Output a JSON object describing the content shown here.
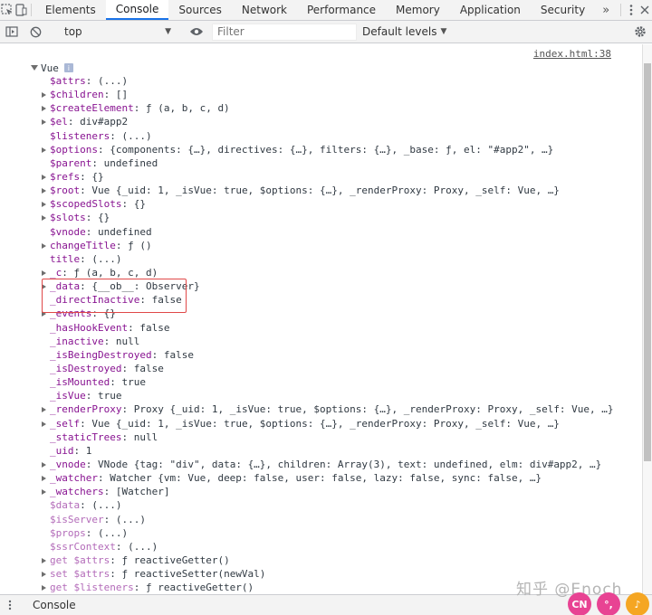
{
  "tabs": {
    "items": [
      "Elements",
      "Console",
      "Sources",
      "Network",
      "Performance",
      "Memory",
      "Application",
      "Security"
    ],
    "active": "Console",
    "more": "»"
  },
  "toolbar": {
    "context": "top",
    "filter_placeholder": "Filter",
    "levels": "Default levels"
  },
  "console": {
    "source_link": "index.html:38",
    "root_label": "Vue",
    "rows": [
      {
        "key": "$attrs",
        "val": "(...)",
        "expandable": false,
        "dim": false
      },
      {
        "key": "$children",
        "val": "[]",
        "expandable": true,
        "dim": false
      },
      {
        "key": "$createElement",
        "val": "ƒ (a, b, c, d)",
        "expandable": true,
        "dim": false
      },
      {
        "key": "$el",
        "val": "div#app2",
        "expandable": true,
        "dim": false
      },
      {
        "key": "$listeners",
        "val": "(...)",
        "expandable": false,
        "dim": false
      },
      {
        "key": "$options",
        "val": "{components: {…}, directives: {…}, filters: {…}, _base: ƒ, el: \"#app2\", …}",
        "expandable": true,
        "dim": false
      },
      {
        "key": "$parent",
        "val": "undefined",
        "expandable": false,
        "dim": false
      },
      {
        "key": "$refs",
        "val": "{}",
        "expandable": true,
        "dim": false
      },
      {
        "key": "$root",
        "val": "Vue {_uid: 1, _isVue: true, $options: {…}, _renderProxy: Proxy, _self: Vue, …}",
        "expandable": true,
        "dim": false
      },
      {
        "key": "$scopedSlots",
        "val": "{}",
        "expandable": true,
        "dim": false
      },
      {
        "key": "$slots",
        "val": "{}",
        "expandable": true,
        "dim": false
      },
      {
        "key": "$vnode",
        "val": "undefined",
        "expandable": false,
        "dim": false
      },
      {
        "key": "changeTitle",
        "val": "ƒ ()",
        "expandable": true,
        "dim": false
      },
      {
        "key": "title",
        "val": "(...)",
        "expandable": false,
        "dim": false
      },
      {
        "key": "_c",
        "val": "ƒ (a, b, c, d)",
        "expandable": true,
        "dim": false
      },
      {
        "key": "_data",
        "val": "{__ob__: Observer}",
        "expandable": true,
        "dim": false
      },
      {
        "key": "_directInactive",
        "val": "false",
        "expandable": false,
        "dim": false
      },
      {
        "key": "_events",
        "val": "{}",
        "expandable": true,
        "dim": false
      },
      {
        "key": "_hasHookEvent",
        "val": "false",
        "expandable": false,
        "dim": false
      },
      {
        "key": "_inactive",
        "val": "null",
        "expandable": false,
        "dim": false
      },
      {
        "key": "_isBeingDestroyed",
        "val": "false",
        "expandable": false,
        "dim": false
      },
      {
        "key": "_isDestroyed",
        "val": "false",
        "expandable": false,
        "dim": false
      },
      {
        "key": "_isMounted",
        "val": "true",
        "expandable": false,
        "dim": false
      },
      {
        "key": "_isVue",
        "val": "true",
        "expandable": false,
        "dim": false
      },
      {
        "key": "_renderProxy",
        "val": "Proxy {_uid: 1, _isVue: true, $options: {…}, _renderProxy: Proxy, _self: Vue, …}",
        "expandable": true,
        "dim": false
      },
      {
        "key": "_self",
        "val": "Vue {_uid: 1, _isVue: true, $options: {…}, _renderProxy: Proxy, _self: Vue, …}",
        "expandable": true,
        "dim": false
      },
      {
        "key": "_staticTrees",
        "val": "null",
        "expandable": false,
        "dim": false
      },
      {
        "key": "_uid",
        "val": "1",
        "expandable": false,
        "dim": false
      },
      {
        "key": "_vnode",
        "val": "VNode {tag: \"div\", data: {…}, children: Array(3), text: undefined, elm: div#app2, …}",
        "expandable": true,
        "dim": false
      },
      {
        "key": "_watcher",
        "val": "Watcher {vm: Vue, deep: false, user: false, lazy: false, sync: false, …}",
        "expandable": true,
        "dim": false
      },
      {
        "key": "_watchers",
        "val": "[Watcher]",
        "expandable": true,
        "dim": false
      },
      {
        "key": "$data",
        "val": "(...)",
        "expandable": false,
        "dim": true
      },
      {
        "key": "$isServer",
        "val": "(...)",
        "expandable": false,
        "dim": true
      },
      {
        "key": "$props",
        "val": "(...)",
        "expandable": false,
        "dim": true
      },
      {
        "key": "$ssrContext",
        "val": "(...)",
        "expandable": false,
        "dim": true
      },
      {
        "key": "get $attrs",
        "val": "ƒ reactiveGetter()",
        "expandable": true,
        "dim": true
      },
      {
        "key": "set $attrs",
        "val": "ƒ reactiveSetter(newVal)",
        "expandable": true,
        "dim": true
      },
      {
        "key": "get $listeners",
        "val": "ƒ reactiveGetter()",
        "expandable": true,
        "dim": true
      }
    ]
  },
  "drawer": {
    "tab": "Console"
  },
  "watermark": "知乎 @Enoch",
  "badges": [
    {
      "text": "CN",
      "color": "#e84393"
    },
    {
      "text": "°,",
      "color": "#e84393"
    },
    {
      "text": "♪",
      "color": "#f5a623"
    }
  ]
}
